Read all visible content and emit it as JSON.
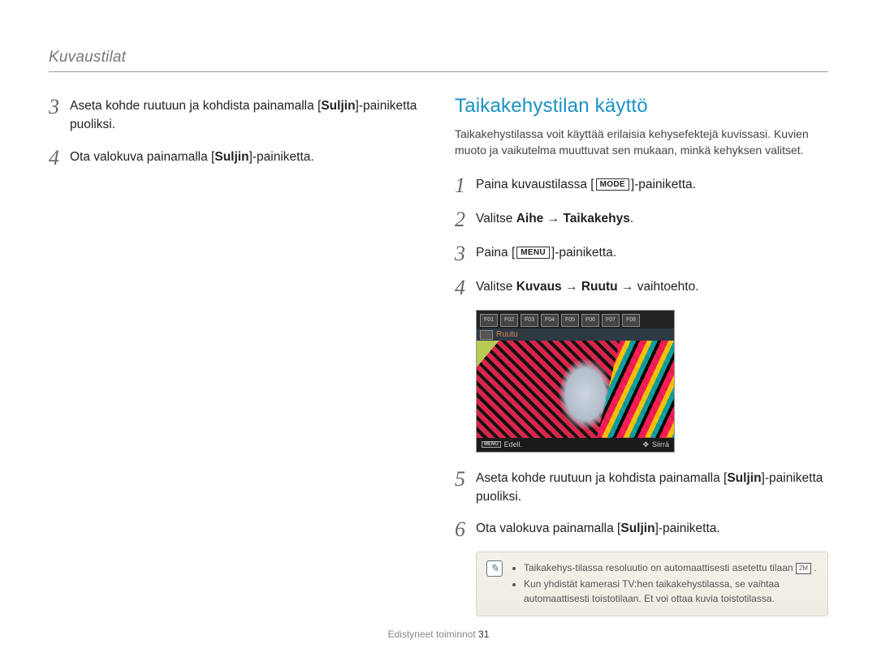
{
  "header": "Kuvaustilat",
  "left": {
    "steps": [
      {
        "num": "3",
        "parts": [
          "Aseta kohde ruutuun ja kohdista painamalla [",
          {
            "b": "Suljin"
          },
          "]-painiketta puoliksi."
        ]
      },
      {
        "num": "4",
        "parts": [
          "Ota valokuva painamalla [",
          {
            "b": "Suljin"
          },
          "]-painiketta."
        ]
      }
    ]
  },
  "right": {
    "title": "Taikakehystilan käyttö",
    "intro": "Taikakehystilassa voit käyttää erilaisia kehysefektejä kuvissasi. Kuvien muoto ja vaikutelma muuttuvat sen mukaan, minkä kehyksen valitset.",
    "steps": [
      {
        "num": "1",
        "parts": [
          "Paina kuvaustilassa [",
          {
            "box": "MODE"
          },
          "]-painiketta."
        ]
      },
      {
        "num": "2",
        "parts": [
          "Valitse ",
          {
            "b": "Aihe"
          },
          " → ",
          {
            "b": "Taikakehys"
          },
          "."
        ]
      },
      {
        "num": "3",
        "parts": [
          "Paina [",
          {
            "box": "MENU"
          },
          "]-painiketta."
        ]
      },
      {
        "num": "4",
        "parts": [
          "Valitse ",
          {
            "b": "Kuvaus"
          },
          " → ",
          {
            "b": "Ruutu"
          },
          " → vaihtoehto."
        ]
      }
    ],
    "screenshot": {
      "frame_label": "Ruutu",
      "bottom_left_button": "MENU",
      "bottom_left": "Edell.",
      "bottom_right": "Siirrä",
      "thumbs": [
        "F01",
        "F02",
        "F03",
        "F04",
        "F05",
        "F06",
        "F07",
        "F08"
      ]
    },
    "steps_after": [
      {
        "num": "5",
        "parts": [
          "Aseta kohde ruutuun ja kohdista painamalla [",
          {
            "b": "Suljin"
          },
          "]-painiketta puoliksi."
        ]
      },
      {
        "num": "6",
        "parts": [
          "Ota valokuva painamalla [",
          {
            "b": "Suljin"
          },
          "]-painiketta."
        ]
      }
    ],
    "notes": [
      {
        "parts": [
          "Taikakehys-tilassa resoluutio on automaattisesti asetettu tilaan ",
          {
            "badge": "2M"
          },
          " ."
        ]
      },
      {
        "parts": [
          "Kun yhdistät kamerasi TV:hen taikakehystilassa, se vaihtaa automaattisesti toistotilaan. Et voi ottaa kuvia toistotilassa."
        ]
      }
    ]
  },
  "footer": {
    "section": "Edistyneet toiminnot",
    "page": "31"
  }
}
